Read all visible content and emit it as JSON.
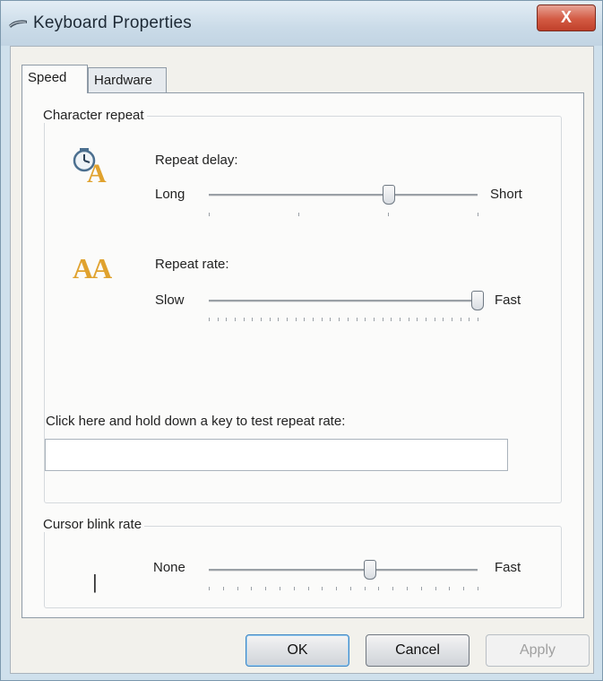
{
  "window": {
    "title": "Keyboard Properties",
    "close_label": "X",
    "icon": "keyboard-icon"
  },
  "tabs": [
    {
      "label": "Speed",
      "active": true
    },
    {
      "label": "Hardware",
      "active": false
    }
  ],
  "character_repeat": {
    "group_label": "Character repeat",
    "repeat_delay": {
      "label": "Repeat delay:",
      "min_label": "Long",
      "max_label": "Short",
      "icon": "repeat-delay-clock-icon",
      "level": 0.67,
      "ticks": 4
    },
    "repeat_rate": {
      "label": "Repeat rate:",
      "min_label": "Slow",
      "max_label": "Fast",
      "icon": "repeat-rate-icon",
      "icon_text": "AA",
      "level": 1.0,
      "ticks": 32
    },
    "test_label": "Click here and hold down a key to test repeat rate:",
    "test_value": ""
  },
  "cursor_blink": {
    "group_label": "Cursor blink rate",
    "cursor_glyph": "|",
    "min_label": "None",
    "max_label": "Fast",
    "level": 0.6,
    "ticks": 20
  },
  "buttons": {
    "ok": "OK",
    "cancel": "Cancel",
    "apply": "Apply"
  },
  "colors": {
    "accent": "#3f86c4",
    "close": "#c8482f",
    "icon_gold": "#e0a22e"
  }
}
